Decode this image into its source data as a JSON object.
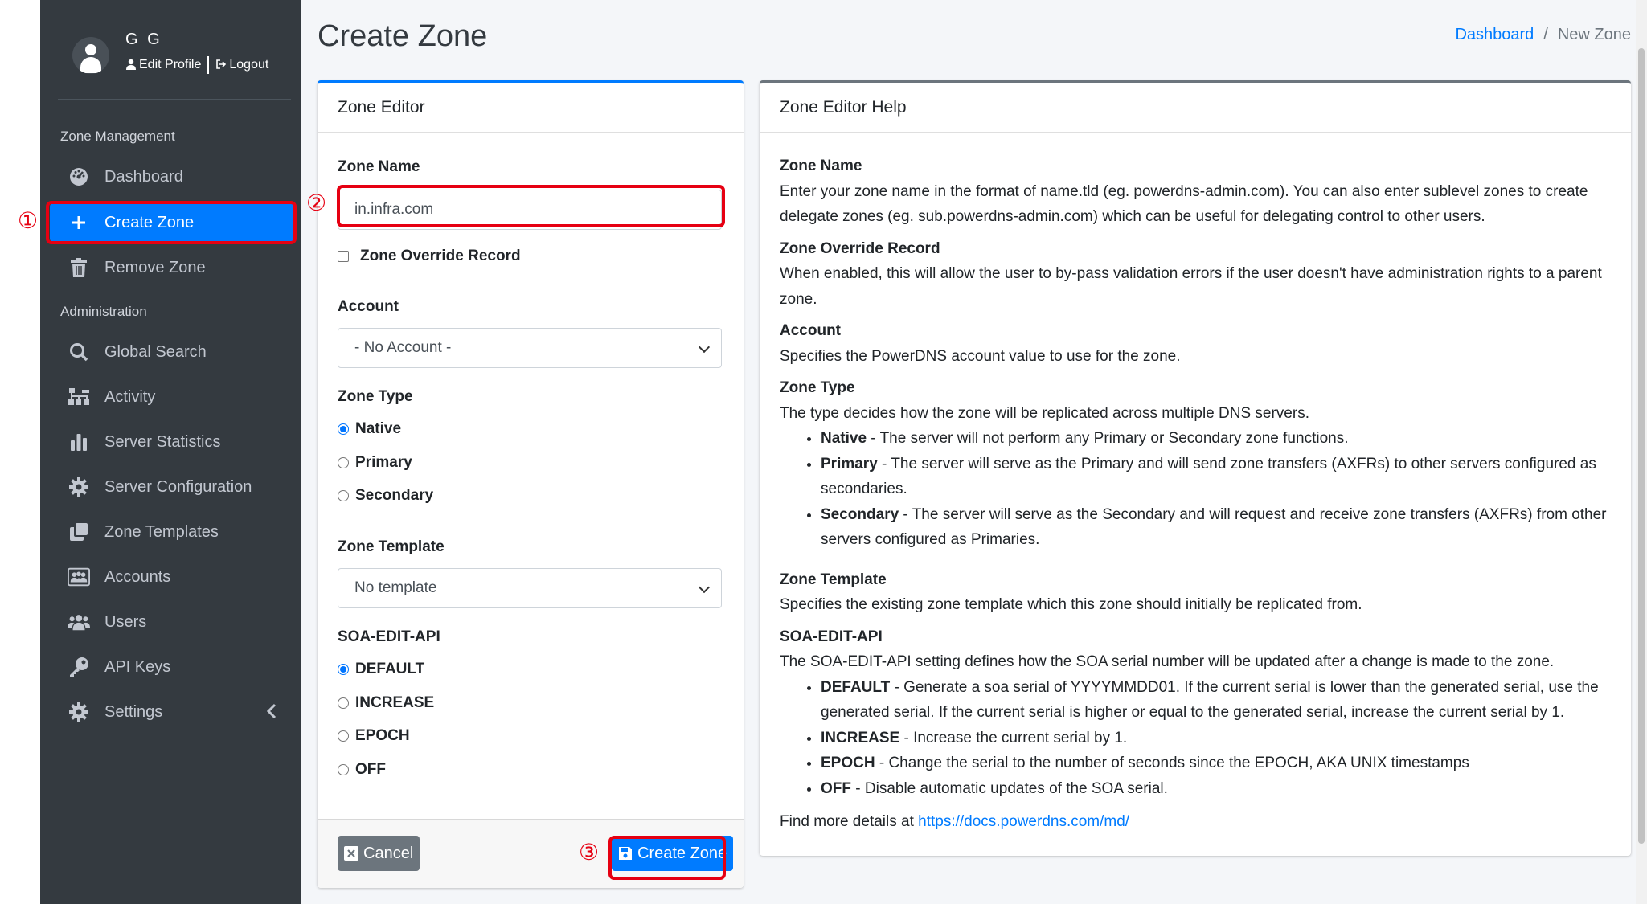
{
  "user": {
    "name": "G G",
    "edit_profile": "Edit Profile",
    "logout": "Logout"
  },
  "sidebar": {
    "section_zone": "Zone Management",
    "section_admin": "Administration",
    "items": [
      {
        "label": "Dashboard",
        "icon": "dashboard-icon"
      },
      {
        "label": "Create Zone",
        "icon": "plus-icon",
        "active": true
      },
      {
        "label": "Remove Zone",
        "icon": "trash-icon"
      },
      {
        "label": "Global Search",
        "icon": "search-icon"
      },
      {
        "label": "Activity",
        "icon": "sitemap-icon"
      },
      {
        "label": "Server Statistics",
        "icon": "chart-icon"
      },
      {
        "label": "Server Configuration",
        "icon": "gear-icon"
      },
      {
        "label": "Zone Templates",
        "icon": "clone-icon"
      },
      {
        "label": "Accounts",
        "icon": "id-card-icon"
      },
      {
        "label": "Users",
        "icon": "users-icon"
      },
      {
        "label": "API Keys",
        "icon": "key-icon"
      },
      {
        "label": "Settings",
        "icon": "gear-icon"
      }
    ]
  },
  "header": {
    "title": "Create Zone",
    "breadcrumb": [
      "Dashboard",
      "New Zone"
    ]
  },
  "annotations": {
    "step1": "①",
    "step2": "②",
    "step3": "③",
    "color": "#e60012"
  },
  "editor": {
    "title": "Zone Editor",
    "zone_name_label": "Zone Name",
    "zone_name_value": "in.infra.com",
    "override_label": "Zone Override Record",
    "account_label": "Account",
    "account_value": "- No Account -",
    "zone_type_label": "Zone Type",
    "zone_types": [
      "Native",
      "Primary",
      "Secondary"
    ],
    "zone_type_selected": "Native",
    "template_label": "Zone Template",
    "template_value": "No template",
    "soa_label": "SOA-EDIT-API",
    "soa_options": [
      "DEFAULT",
      "INCREASE",
      "EPOCH",
      "OFF"
    ],
    "soa_selected": "DEFAULT",
    "cancel_label": "Cancel",
    "create_label": "Create Zone"
  },
  "help": {
    "title": "Zone Editor Help",
    "zone_name_h": "Zone Name",
    "zone_name_p": "Enter your zone name in the format of name.tld (eg. powerdns-admin.com). You can also enter sublevel zones to create delegate zones (eg. sub.powerdns-admin.com) which can be useful for delegating control to other users.",
    "override_h": "Zone Override Record",
    "override_p": "When enabled, this will allow the user to by-pass validation errors if the user doesn't have administration rights to a parent zone.",
    "account_h": "Account",
    "account_p": "Specifies the PowerDNS account value to use for the zone.",
    "type_h": "Zone Type",
    "type_p": "The type decides how the zone will be replicated across multiple DNS servers.",
    "type_native_b": "Native",
    "type_native_t": " - The server will not perform any Primary or Secondary zone functions.",
    "type_primary_b": "Primary",
    "type_primary_t": " - The server will serve as the Primary and will send zone transfers (AXFRs) to other servers configured as secondaries.",
    "type_secondary_b": "Secondary",
    "type_secondary_t": " - The server will serve as the Secondary and will request and receive zone transfers (AXFRs) from other servers configured as Primaries.",
    "template_h": "Zone Template",
    "template_p": "Specifies the existing zone template which this zone should initially be replicated from.",
    "soa_h": "SOA-EDIT-API",
    "soa_p": "The SOA-EDIT-API setting defines how the SOA serial number will be updated after a change is made to the zone.",
    "soa_default_b": "DEFAULT",
    "soa_default_t": " - Generate a soa serial of YYYYMMDD01. If the current serial is lower than the generated serial, use the generated serial. If the current serial is higher or equal to the generated serial, increase the current serial by 1.",
    "soa_increase_b": "INCREASE",
    "soa_increase_t": " - Increase the current serial by 1.",
    "soa_epoch_b": "EPOCH",
    "soa_epoch_t": " - Change the serial to the number of seconds since the EPOCH, AKA UNIX timestamps",
    "soa_off_b": "OFF",
    "soa_off_t": " - Disable automatic updates of the SOA serial.",
    "more_text": "Find more details at ",
    "more_link": "https://docs.powerdns.com/md/"
  }
}
